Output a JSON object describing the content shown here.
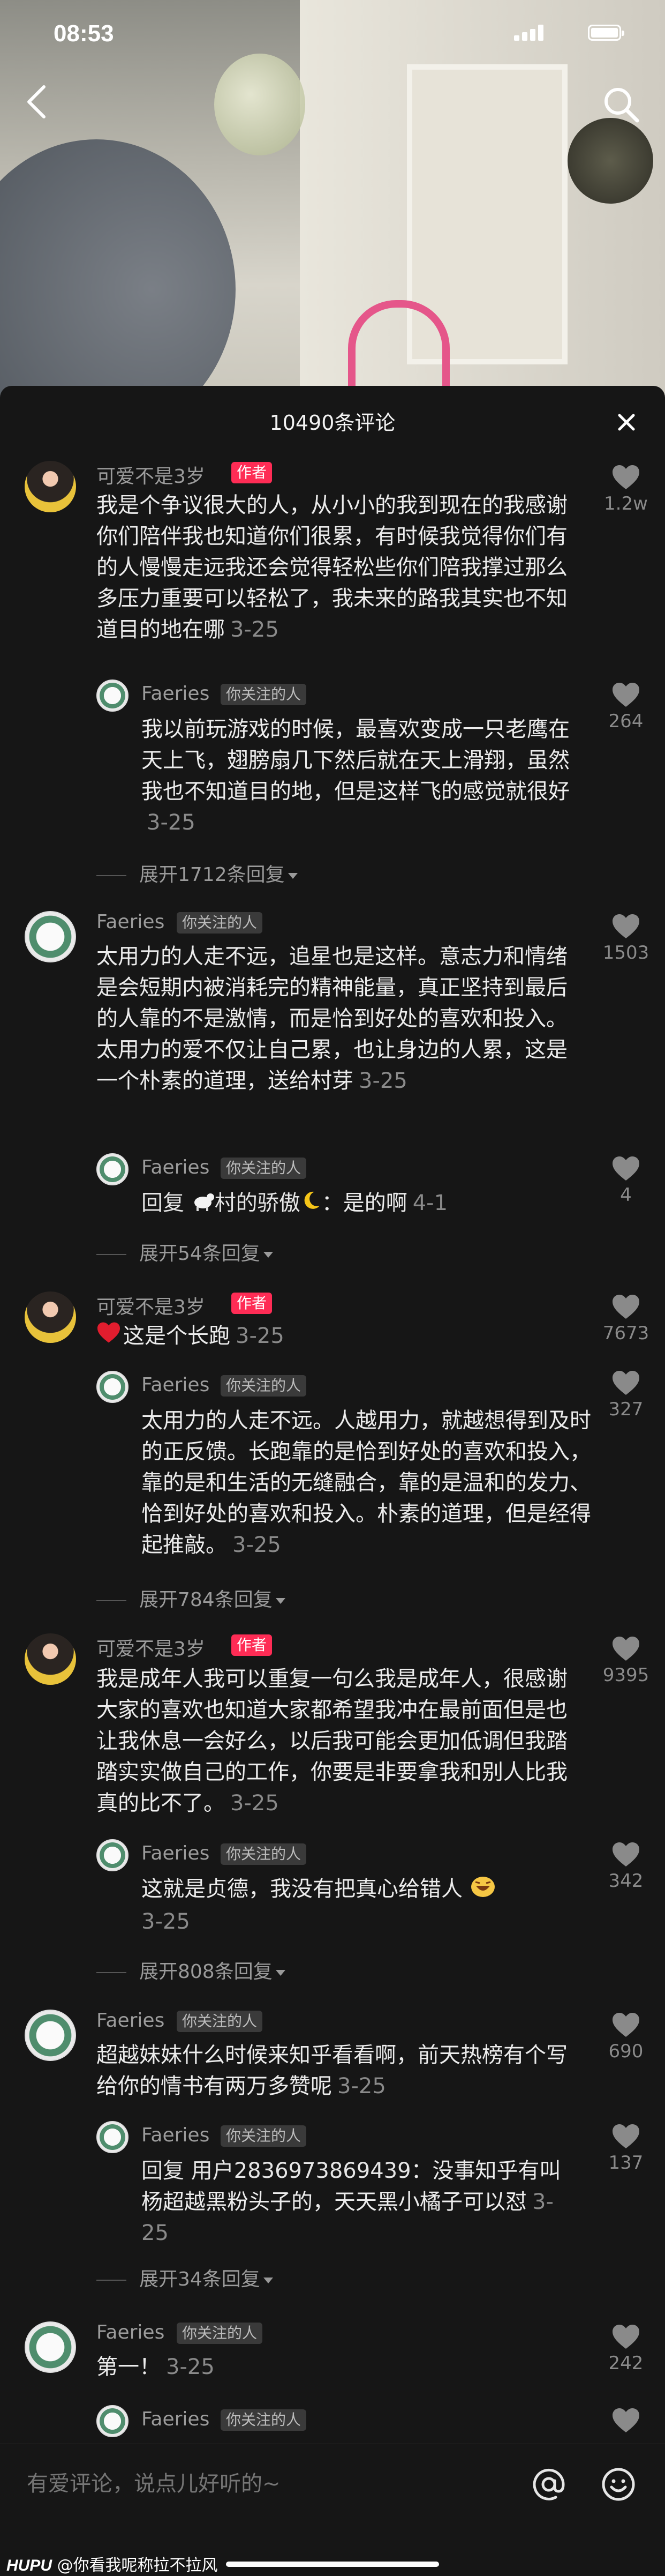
{
  "status_bar": {
    "time": "08:53"
  },
  "panel": {
    "title": "10490条评论"
  },
  "comments": [
    {
      "name": "可爱不是3岁",
      "tag": "作者",
      "text": "我是个争议很大的人，从小小的我到现在的我感谢你们陪伴我也知道你们很累，有时候我觉得你们有的人慢慢走远我还会觉得轻松些你们陪我撑过那么多压力重要可以轻松了，我未来的路我其实也不知道目的地在哪",
      "date": "3-25",
      "likes": "1.2w"
    },
    {
      "name": "Faeries",
      "tag": "你关注的人",
      "text": "我以前玩游戏的时候，最喜欢变成一只老鹰在天上飞，翅膀扇几下然后就在天上滑翔，虽然我也不知道目的地，但是这样飞的感觉就很好",
      "date": "3-25",
      "likes": "264"
    },
    {
      "expand": "展开1712条回复"
    },
    {
      "name": "Faeries",
      "tag": "你关注的人",
      "text": "太用力的人走不远，追星也是这样。意志力和情绪是会短期内被消耗完的精神能量，真正坚持到最后的人靠的不是激情，而是恰到好处的喜欢和投入。太用力的爱不仅让自己累，也让身边的人累，这是一个朴素的道理，送给村芽",
      "date": "3-25",
      "likes": "1503"
    },
    {
      "name": "Faeries",
      "tag": "你关注的人",
      "reply_prefix": "回复",
      "reply_to": "村的骄傲",
      "text": "：是的啊",
      "date": "4-1",
      "likes": "4"
    },
    {
      "expand": "展开54条回复"
    },
    {
      "name": "可爱不是3岁",
      "tag": "作者",
      "text": "这是个长跑",
      "date": "3-25",
      "likes": "7673"
    },
    {
      "name": "Faeries",
      "tag": "你关注的人",
      "text": "太用力的人走不远。人越用力，就越想得到及时的正反馈。长跑靠的是恰到好处的喜欢和投入，靠的是和生活的无缝融合，靠的是温和的发力、恰到好处的喜欢和投入。朴素的道理，但是经得起推敲。",
      "date": "3-25",
      "likes": "327"
    },
    {
      "expand": "展开784条回复"
    },
    {
      "name": "可爱不是3岁",
      "tag": "作者",
      "text": "我是成年人我可以重复一句么我是成年人，很感谢大家的喜欢也知道大家都希望我冲在最前面但是也让我休息一会好么，以后我可能会更加低调但我踏踏实实做自己的工作，你要是非要拿我和别人比我真的比不了。",
      "date": "3-25",
      "likes": "9395"
    },
    {
      "name": "Faeries",
      "tag": "你关注的人",
      "text": "这就是贞德，我没有把真心给错人",
      "date": "3-25",
      "likes": "342"
    },
    {
      "expand": "展开808条回复"
    },
    {
      "name": "Faeries",
      "tag": "你关注的人",
      "text": "超越妹妹什么时候来知乎看看啊，前天热榜有个写给你的情书有两万多赞呢",
      "date": "3-25",
      "likes": "690"
    },
    {
      "name": "Faeries",
      "tag": "你关注的人",
      "reply_prefix": "回复",
      "reply_to": "用户2836973869439",
      "text": "：没事知乎有叫杨超越黑粉头子的，天天黑小橘子可以怼",
      "date": "3-25",
      "likes": "137"
    },
    {
      "expand": "展开34条回复"
    },
    {
      "name": "Faeries",
      "tag": "你关注的人",
      "text": "第一！",
      "date": "3-25",
      "likes": "242"
    },
    {
      "name": "Faeries",
      "tag": "你关注的人",
      "text": "",
      "date": "",
      "likes": ""
    }
  ],
  "input": {
    "placeholder": "有爱评论，说点儿好听的~"
  },
  "watermark": {
    "brand": "HUPU",
    "text": "@你看我呢称拉不拉风"
  },
  "colors": {
    "author_tag": "#fe2c55",
    "background": "#161616"
  }
}
